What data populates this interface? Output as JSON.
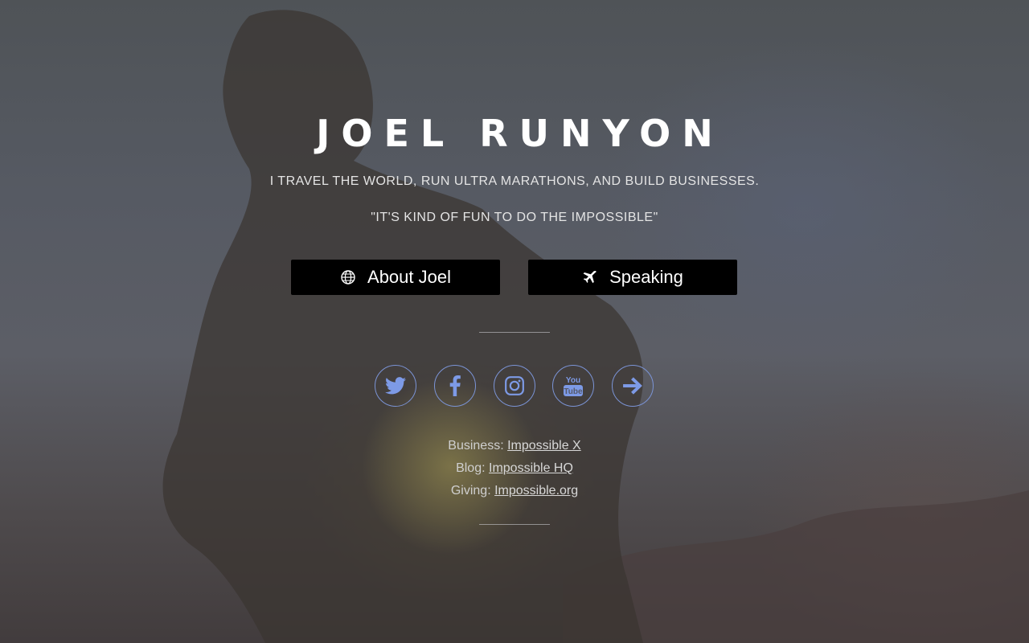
{
  "hero": {
    "title": "JOEL RUNYON",
    "tagline": "I TRAVEL THE WORLD, RUN ULTRA MARATHONS, AND BUILD BUSINESSES.",
    "quote": "\"IT'S KIND OF FUN TO DO THE IMPOSSIBLE\""
  },
  "buttons": {
    "about_label": "About Joel",
    "about_icon": "globe-icon",
    "speaking_label": "Speaking",
    "speaking_icon": "airplane-icon"
  },
  "social": {
    "icon_color": "#7d9ae6",
    "items": [
      "twitter-icon",
      "facebook-icon",
      "instagram-icon",
      "youtube-icon",
      "arrow-right-icon"
    ]
  },
  "links": {
    "business_label": "Business:",
    "business_link": "Impossible X",
    "blog_label": "Blog:",
    "blog_link": "Impossible HQ",
    "giving_label": "Giving:",
    "giving_link": "Impossible.org"
  }
}
